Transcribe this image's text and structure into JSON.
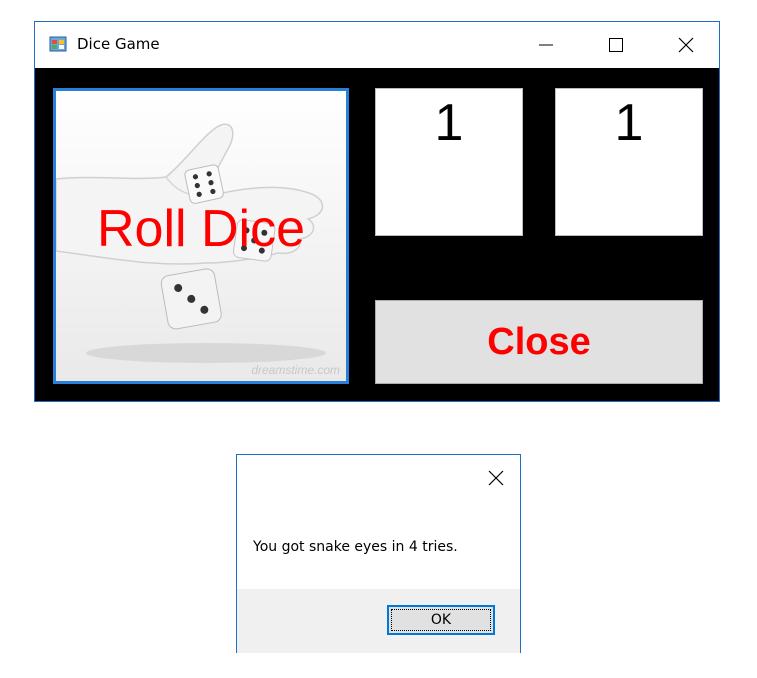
{
  "main_window": {
    "title": "Dice Game",
    "icon": "app-window-icon",
    "roll_button": {
      "label": "Roll Dice",
      "image_watermark": "dreamstime.com",
      "label_color": "#ff0000"
    },
    "die_left": {
      "value": "1"
    },
    "die_right": {
      "value": "1"
    },
    "close_button": {
      "label": "Close",
      "label_color": "#ff0000"
    },
    "client_background": "#000000"
  },
  "message_box": {
    "text": "You got snake eyes in 4 tries.",
    "ok_label": "OK",
    "accent": "#0078d7"
  }
}
